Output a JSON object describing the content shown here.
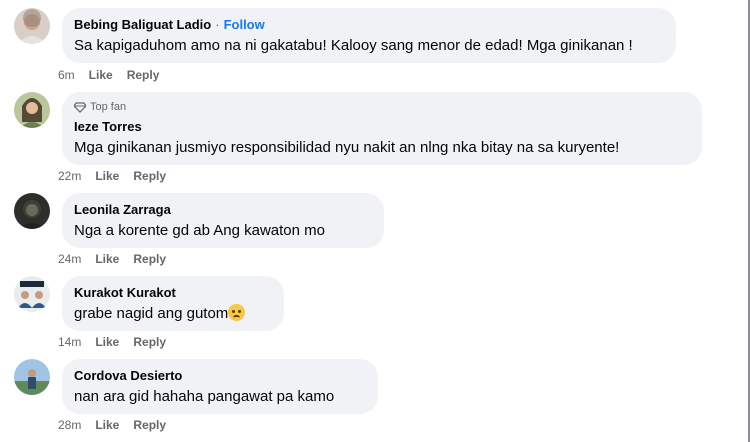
{
  "comments": [
    {
      "name": "Bebing Baliguat Ladio",
      "follow": "Follow",
      "text": "Sa kapigaduhom amo na ni gakatabu! Kalooy sang menor de edad! Mga ginikanan !",
      "time": "6m",
      "like": "Like",
      "reply": "Reply"
    },
    {
      "badge": "Top fan",
      "name": "Ieze Torres",
      "text": "Mga ginikanan jusmiyo responsibilidad nyu nakit an nlng nka bitay na sa kuryente!",
      "time": "22m",
      "like": "Like",
      "reply": "Reply"
    },
    {
      "name": "Leonila Zarraga",
      "text": "Nga a korente gd ab Ang kawaton mo",
      "time": "24m",
      "like": "Like",
      "reply": "Reply"
    },
    {
      "name": "Kurakot Kurakot",
      "text": "grabe nagid ang gutom",
      "emoji": "crying-face",
      "time": "14m",
      "like": "Like",
      "reply": "Reply"
    },
    {
      "name": "Cordova Desierto",
      "text": "nan ara gid hahaha pangawat pa kamo",
      "time": "28m",
      "like": "Like",
      "reply": "Reply"
    }
  ],
  "colors": {
    "bubble": "#f0f2f5",
    "link": "#1877f2",
    "meta": "#65676b"
  }
}
